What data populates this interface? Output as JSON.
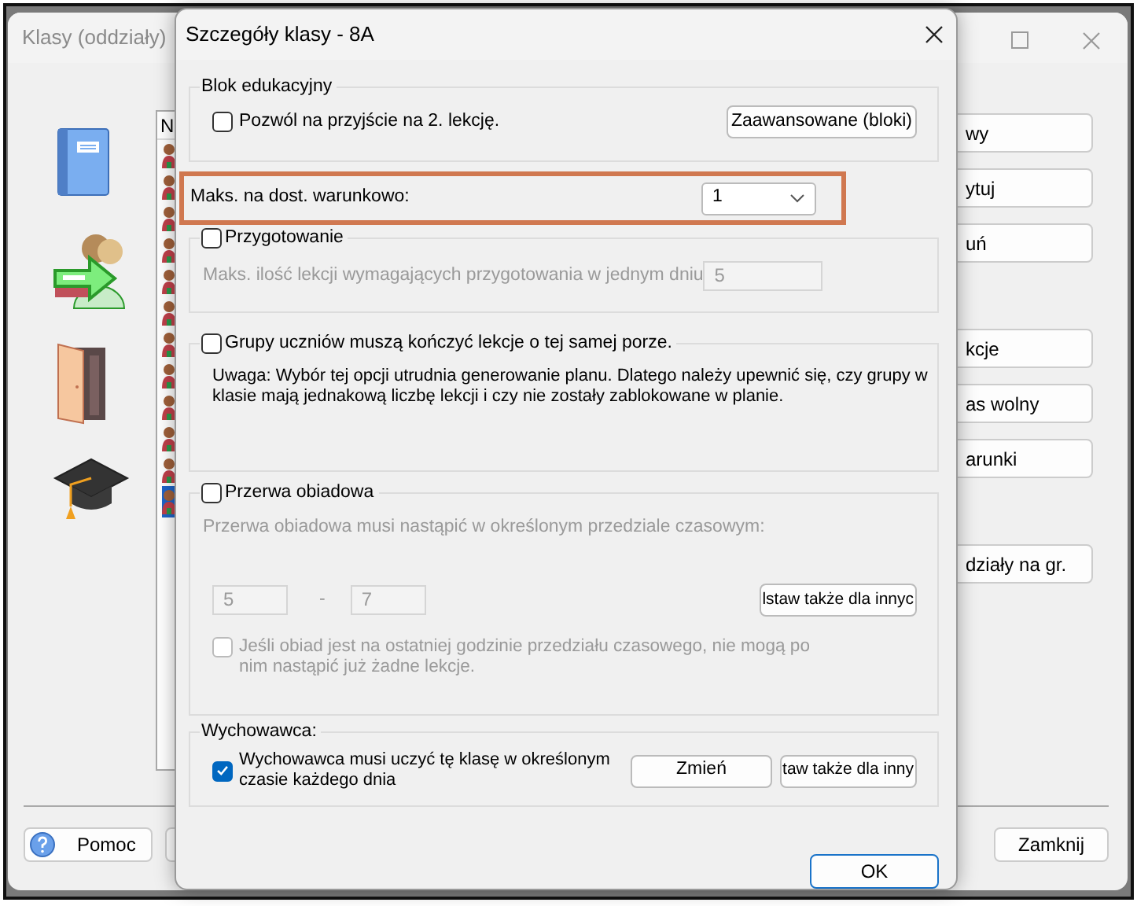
{
  "main_window": {
    "title": "Klasy (oddziały)",
    "list": {
      "header": "N",
      "rows": [
        {
          "selected": false
        },
        {
          "selected": false
        },
        {
          "selected": false
        },
        {
          "selected": false
        },
        {
          "selected": false
        },
        {
          "selected": false
        },
        {
          "selected": false
        },
        {
          "selected": false
        },
        {
          "selected": false
        },
        {
          "selected": false
        },
        {
          "selected": false
        },
        {
          "selected": true
        }
      ]
    },
    "side_button_groups": [
      [
        "wy",
        "ytuj",
        "uń"
      ],
      [
        "kcje",
        "as wolny",
        "arunki"
      ],
      [
        "działy na gr."
      ]
    ],
    "help_button": "Pomoc",
    "close_button": "Zamknij"
  },
  "dialog": {
    "title": "Szczegóły klasy - 8A",
    "block_group": {
      "legend": "Blok edukacyjny",
      "checkbox": {
        "label": "Pozwól na przyjście na 2. lekcję.",
        "checked": false
      },
      "button": "Zaawansowane (bloki)"
    },
    "conditional": {
      "label": "Maks. na dost. warunkowo:",
      "value": "1",
      "highlighted": true
    },
    "preparation": {
      "checkbox": {
        "label": "Przygotowanie",
        "checked": false
      },
      "field_label": "Maks. ilość lekcji wymagających przygotowania w jednym dniu",
      "value": "5"
    },
    "same_end": {
      "checkbox": {
        "label": "Grupy uczniów muszą kończyć lekcje o tej samej porze.",
        "checked": false
      },
      "note": "Uwaga: Wybór tej opcji utrudnia generowanie planu. Dlatego należy upewnić się, czy grupy w klasie mają jednakową liczbę lekcji i czy nie zostały zablokowane w planie."
    },
    "lunch": {
      "checkbox": {
        "label": "Przerwa obiadowa",
        "checked": false
      },
      "description": "Przerwa obiadowa musi nastąpić w określonym przedziale czasowym:",
      "from": "5",
      "separator": "-",
      "to": "7",
      "apply_button": "lstaw także dla innyc",
      "last_hour_checkbox": {
        "label": "Jeśli obiad jest na ostatniej godzinie przedziału czasowego, nie mogą po nim nastąpić już żadne lekcje.",
        "checked": false
      }
    },
    "homeroom": {
      "legend": "Wychowawca:",
      "checkbox": {
        "label": "Wychowawca musi uczyć tę klasę w określonym czasie każdego dnia",
        "checked": true
      },
      "change_button": "Zmień",
      "apply_button": "taw także dla inny"
    },
    "ok_button": "OK"
  }
}
